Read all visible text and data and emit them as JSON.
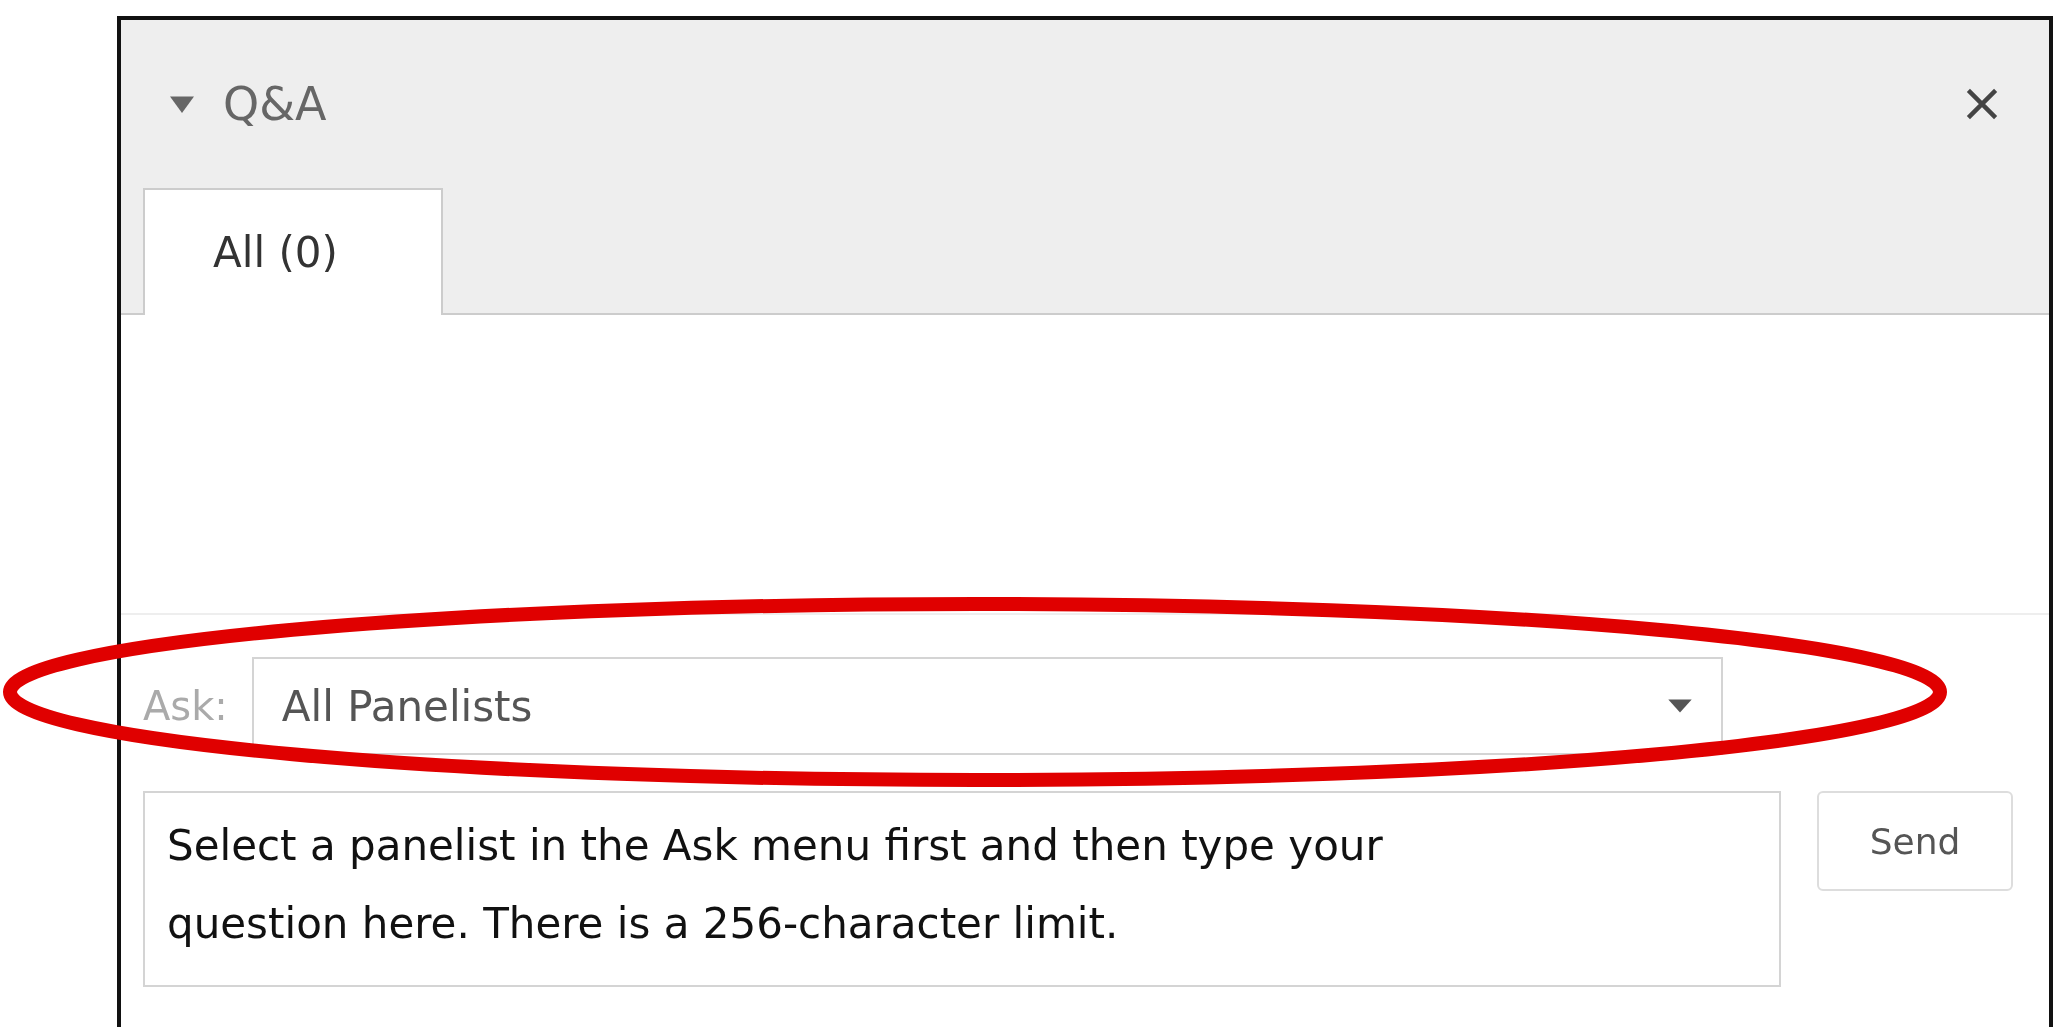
{
  "panel": {
    "title": "Q&A",
    "expanded": true
  },
  "tabs": [
    {
      "label": "All (0)",
      "selected": true
    }
  ],
  "ask": {
    "label": "Ask:",
    "value": "All Panelists"
  },
  "question": {
    "placeholder": "Select a panelist in the Ask menu first and then type your question here. There is a 256-character limit."
  },
  "send_button": {
    "label": "Send"
  }
}
